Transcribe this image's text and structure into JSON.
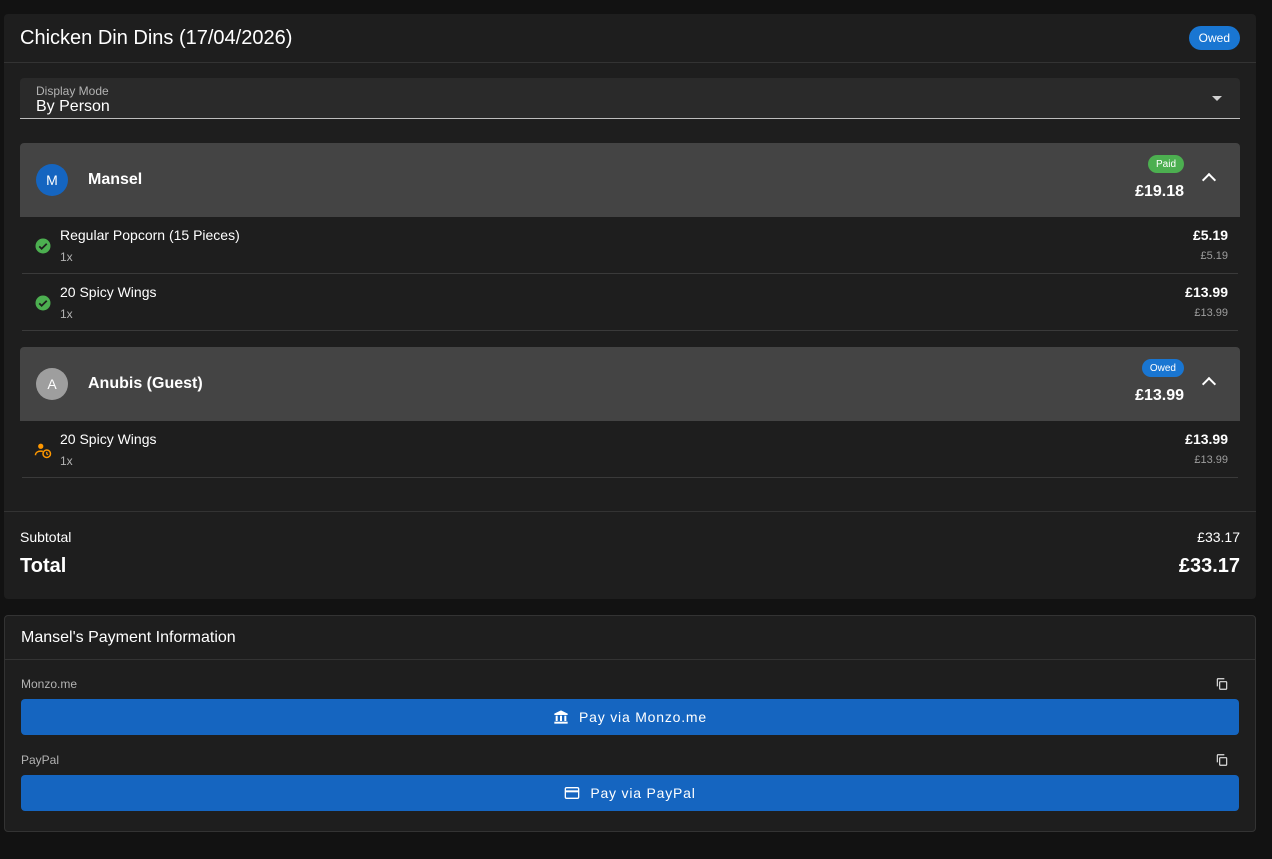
{
  "order": {
    "title": "Chicken Din Dins (17/04/2026)",
    "status": "Owed"
  },
  "display_mode": {
    "label": "Display Mode",
    "value": "By Person"
  },
  "people": [
    {
      "initial": "M",
      "name": "Mansel",
      "status": "Paid",
      "amount": "£19.18",
      "items": [
        {
          "name": "Regular Popcorn (15 Pieces)",
          "qty": "1x",
          "price": "£5.19",
          "unit_price": "£5.19",
          "state_icon": "check-circle-icon"
        },
        {
          "name": "20 Spicy Wings",
          "qty": "1x",
          "price": "£13.99",
          "unit_price": "£13.99",
          "state_icon": "check-circle-icon"
        }
      ]
    },
    {
      "initial": "A",
      "name": "Anubis (Guest)",
      "status": "Owed",
      "amount": "£13.99",
      "items": [
        {
          "name": "20 Spicy Wings",
          "qty": "1x",
          "price": "£13.99",
          "unit_price": "£13.99",
          "state_icon": "person-clock-icon"
        }
      ]
    }
  ],
  "totals": {
    "subtotal_label": "Subtotal",
    "subtotal_value": "£33.17",
    "total_label": "Total",
    "total_value": "£33.17"
  },
  "payment": {
    "title": "Mansel's Payment Information",
    "methods": [
      {
        "label": "Monzo.me",
        "button": "Pay via Monzo.me",
        "icon": "bank-icon"
      },
      {
        "label": "PayPal",
        "button": "Pay via PayPal",
        "icon": "credit-card-icon"
      }
    ]
  },
  "colors": {
    "background": "#121212",
    "card": "#1e1e1e",
    "accent_blue": "#1565c0",
    "paid_green": "#4caf50",
    "pending_orange": "#ff9800"
  }
}
